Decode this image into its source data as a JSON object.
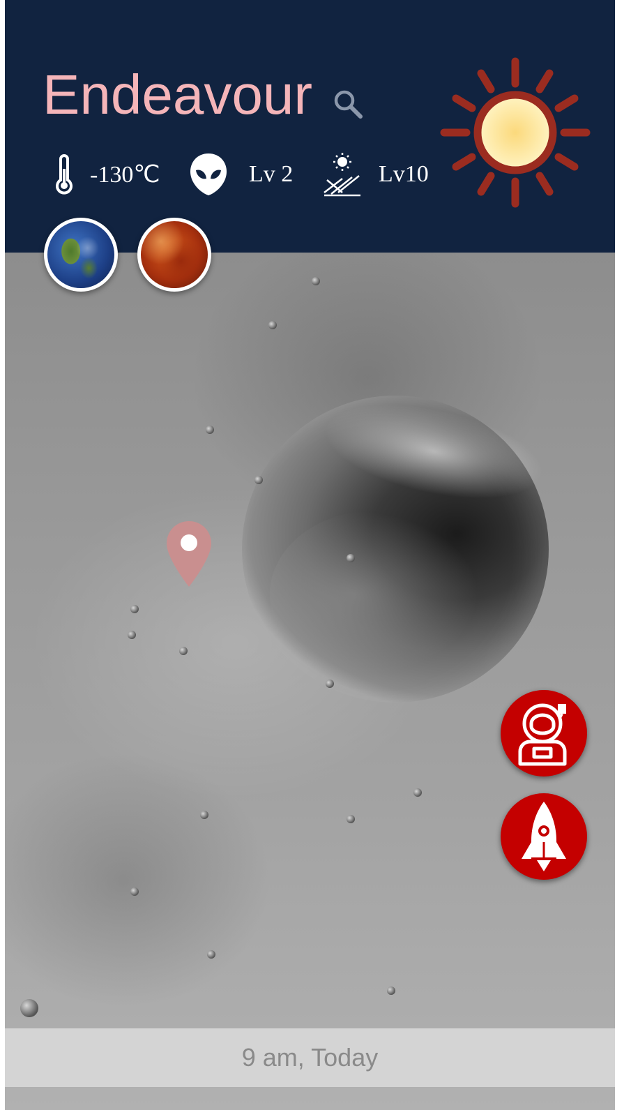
{
  "header": {
    "site_name": "Endeavour",
    "search_icon": "search-icon",
    "weather_icon": "sun-icon"
  },
  "stats": {
    "temperature": {
      "icon": "thermometer-icon",
      "value": "-130℃"
    },
    "alien": {
      "icon": "alien-icon",
      "value": "Lv 2"
    },
    "radiation": {
      "icon": "solar-radiation-icon",
      "value": "Lv10"
    }
  },
  "planets": [
    {
      "name": "earth",
      "icon": "earth-icon"
    },
    {
      "name": "mars",
      "icon": "mars-icon"
    }
  ],
  "map": {
    "marker_icon": "location-pin-icon"
  },
  "actions": [
    {
      "icon": "astronaut-icon"
    },
    {
      "icon": "rocket-icon"
    }
  ],
  "footer": {
    "time_label": "9 am, Today"
  },
  "colors": {
    "header_bg": "#112340",
    "title": "#f5b5b9",
    "action_red": "#c40000",
    "pin": "#c98f8f",
    "sun_ray": "#9b2c20"
  }
}
